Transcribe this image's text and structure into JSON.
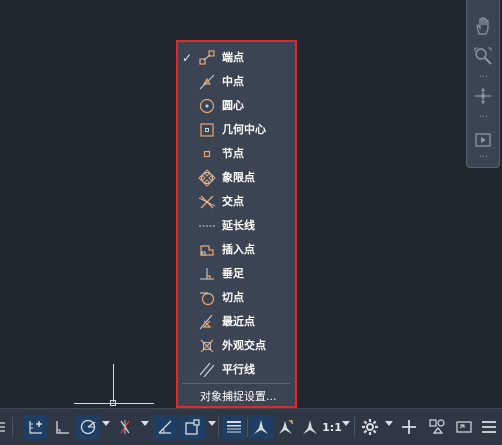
{
  "osnap_menu": {
    "items": [
      {
        "label": "端点",
        "icon": "endpoint-icon",
        "checked": true
      },
      {
        "label": "中点",
        "icon": "midpoint-icon",
        "checked": false
      },
      {
        "label": "圆心",
        "icon": "center-icon",
        "checked": false
      },
      {
        "label": "几何中心",
        "icon": "geometric-center-icon",
        "checked": false
      },
      {
        "label": "节点",
        "icon": "node-icon",
        "checked": false
      },
      {
        "label": "象限点",
        "icon": "quadrant-icon",
        "checked": false
      },
      {
        "label": "交点",
        "icon": "intersection-icon",
        "checked": false
      },
      {
        "label": "延长线",
        "icon": "extension-icon",
        "checked": false
      },
      {
        "label": "插入点",
        "icon": "insertion-icon",
        "checked": false
      },
      {
        "label": "垂足",
        "icon": "perpendicular-icon",
        "checked": false
      },
      {
        "label": "切点",
        "icon": "tangent-icon",
        "checked": false
      },
      {
        "label": "最近点",
        "icon": "nearest-icon",
        "checked": false
      },
      {
        "label": "外观交点",
        "icon": "apparent-intersection-icon",
        "checked": false
      },
      {
        "label": "平行线",
        "icon": "parallel-icon",
        "checked": false
      }
    ],
    "check_mark": "✓",
    "settings_label": "对象捕捉设置..."
  },
  "statusbar": {
    "annotation_scale": "1:1"
  },
  "colors": {
    "canvas": "#212830",
    "menu_bg": "#3b4453",
    "highlight_border": "#e02a2a",
    "snap_icon": "#e8a774",
    "statusbar_bg": "#2f3744",
    "active_button": "#1f3e63"
  }
}
